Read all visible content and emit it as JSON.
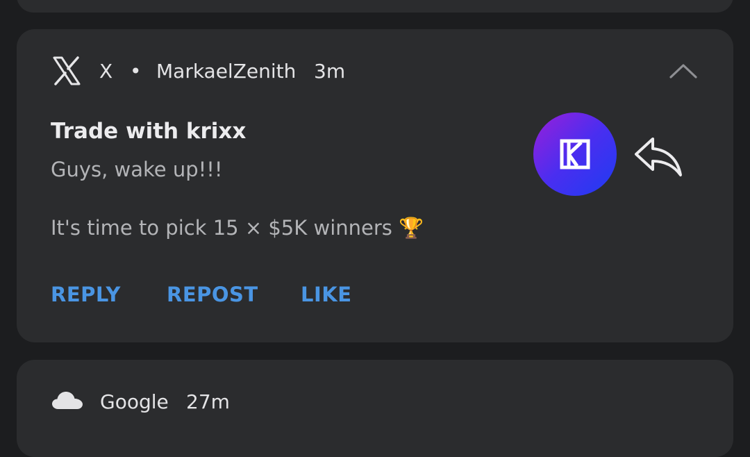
{
  "notification_x": {
    "app_name": "X",
    "separator": "•",
    "account": "MarkaelZenith",
    "time": "3m",
    "title": "Trade with krixx",
    "body_line_1": "Guys, wake up!!!",
    "body_line_2": "It's time to pick 15 × $5K winners 🏆",
    "actions": {
      "reply": "REPLY",
      "repost": "REPOST",
      "like": "LIKE"
    },
    "icons": {
      "app": "x-logo-icon",
      "collapse": "chevron-up-icon",
      "avatar": "krixx-logo-avatar",
      "reply": "reply-arrow-icon"
    },
    "colors": {
      "action_text": "#4a95e3",
      "card_background": "#2b2c2e",
      "avatar_gradient_start": "#9a1fd9",
      "avatar_gradient_end": "#1e3cf2"
    }
  },
  "notification_google": {
    "app_name": "Google",
    "time": "27m",
    "icon": "cloud-icon"
  }
}
